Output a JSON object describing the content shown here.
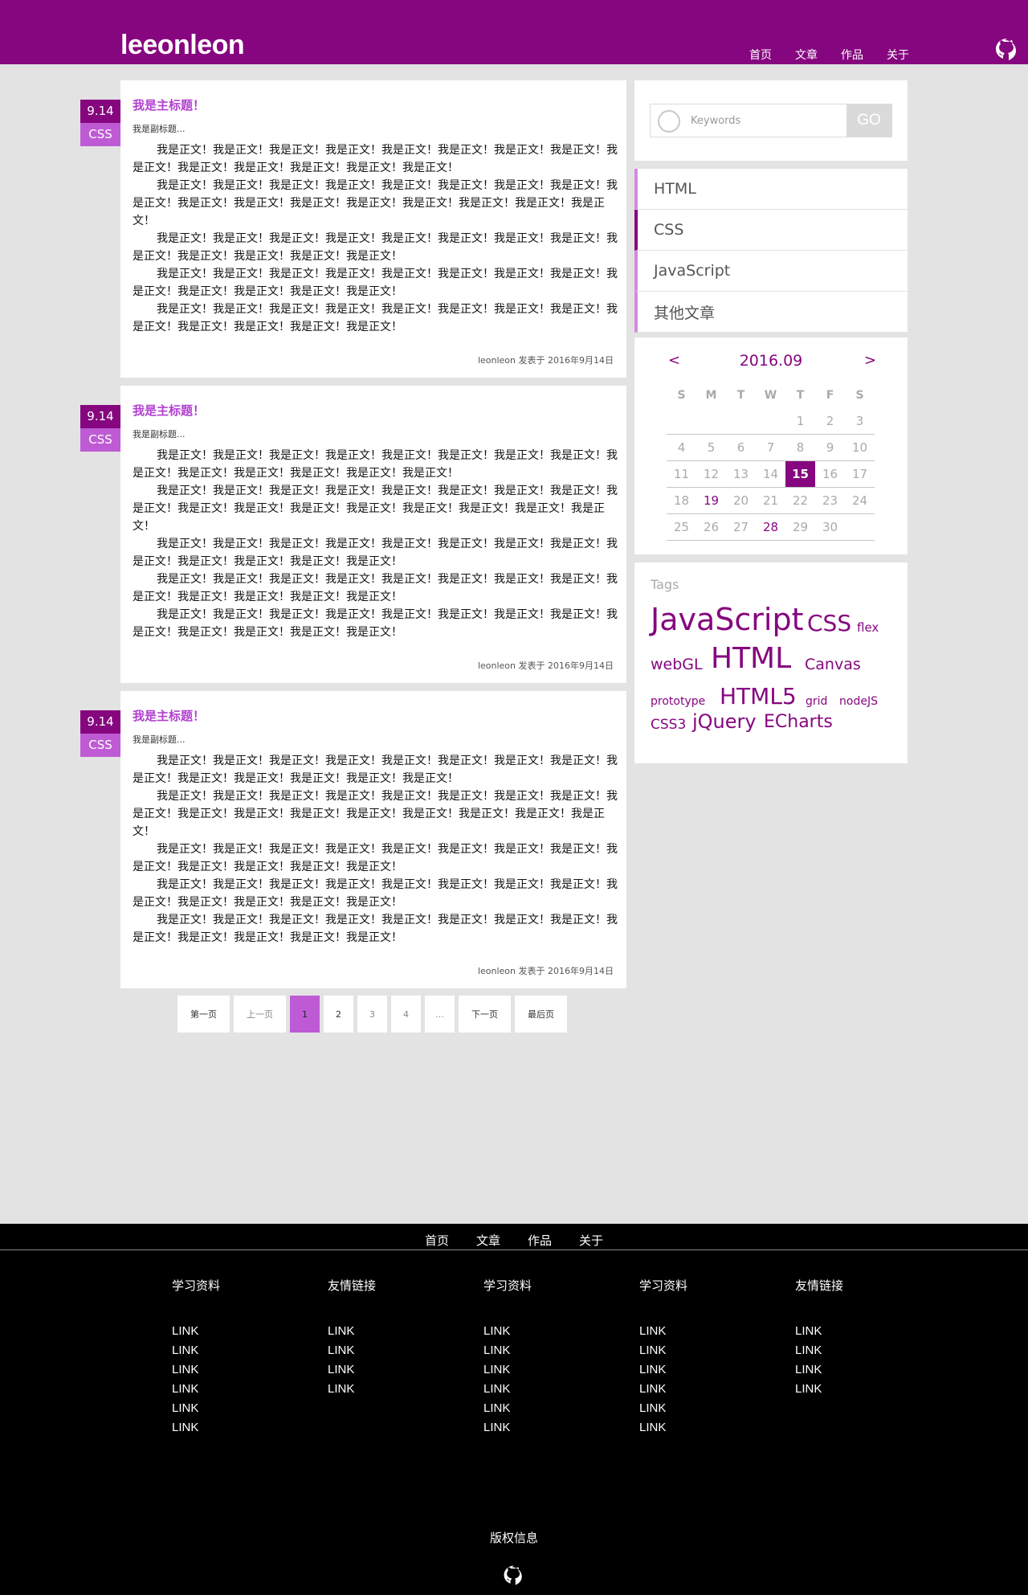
{
  "header": {
    "logo": "leeonleon",
    "nav": [
      "首页",
      "文章",
      "作品",
      "关于"
    ]
  },
  "posts": [
    {
      "date": "9.14",
      "category": "CSS",
      "title": "我是主标题！",
      "subtitle": "我是副标题...",
      "paragraphs": [
        "我是正文！我是正文！我是正文！我是正文！我是正文！我是正文！我是正文！我是正文！我是正文！我是正文！我是正文！我是正文！我是正文！我是正文！",
        "我是正文！我是正文！我是正文！我是正文！我是正文！我是正文！我是正文！我是正文！我是正文！我是正文！我是正文！我是正文！我是正文！我是正文！我是正文！我是正文！我是正文！",
        "我是正文！我是正文！我是正文！我是正文！我是正文！我是正文！我是正文！我是正文！我是正文！我是正文！我是正文！我是正文！我是正文！",
        "我是正文！我是正文！我是正文！我是正文！我是正文！我是正文！我是正文！我是正文！我是正文！我是正文！我是正文！我是正文！我是正文！",
        "我是正文！我是正文！我是正文！我是正文！我是正文！我是正文！我是正文！我是正文！我是正文！我是正文！我是正文！我是正文！我是正文！"
      ],
      "meta": "leonleon 发表于 2016年9月14日"
    },
    {
      "date": "9.14",
      "category": "CSS",
      "title": "我是主标题！",
      "subtitle": "我是副标题...",
      "paragraphs": [
        "我是正文！我是正文！我是正文！我是正文！我是正文！我是正文！我是正文！我是正文！我是正文！我是正文！我是正文！我是正文！我是正文！我是正文！",
        "我是正文！我是正文！我是正文！我是正文！我是正文！我是正文！我是正文！我是正文！我是正文！我是正文！我是正文！我是正文！我是正文！我是正文！我是正文！我是正文！我是正文！",
        "我是正文！我是正文！我是正文！我是正文！我是正文！我是正文！我是正文！我是正文！我是正文！我是正文！我是正文！我是正文！我是正文！",
        "我是正文！我是正文！我是正文！我是正文！我是正文！我是正文！我是正文！我是正文！我是正文！我是正文！我是正文！我是正文！我是正文！",
        "我是正文！我是正文！我是正文！我是正文！我是正文！我是正文！我是正文！我是正文！我是正文！我是正文！我是正文！我是正文！我是正文！"
      ],
      "meta": "leonleon 发表于 2016年9月14日"
    },
    {
      "date": "9.14",
      "category": "CSS",
      "title": "我是主标题！",
      "subtitle": "我是副标题...",
      "paragraphs": [
        "我是正文！我是正文！我是正文！我是正文！我是正文！我是正文！我是正文！我是正文！我是正文！我是正文！我是正文！我是正文！我是正文！我是正文！",
        "我是正文！我是正文！我是正文！我是正文！我是正文！我是正文！我是正文！我是正文！我是正文！我是正文！我是正文！我是正文！我是正文！我是正文！我是正文！我是正文！我是正文！",
        "我是正文！我是正文！我是正文！我是正文！我是正文！我是正文！我是正文！我是正文！我是正文！我是正文！我是正文！我是正文！我是正文！",
        "我是正文！我是正文！我是正文！我是正文！我是正文！我是正文！我是正文！我是正文！我是正文！我是正文！我是正文！我是正文！我是正文！",
        "我是正文！我是正文！我是正文！我是正文！我是正文！我是正文！我是正文！我是正文！我是正文！我是正文！我是正文！我是正文！我是正文！"
      ],
      "meta": "leonleon 发表于 2016年9月14日"
    }
  ],
  "pagination": {
    "first": "第一页",
    "prev": "上一页",
    "pages": [
      "1",
      "2",
      "3",
      "4",
      "..."
    ],
    "current": "1",
    "next": "下一页",
    "last": "最后页"
  },
  "search": {
    "placeholder": "Keywords",
    "button": "GO"
  },
  "categories": [
    "HTML",
    "CSS",
    "JavaScript",
    "其他文章"
  ],
  "active_category": "CSS",
  "calendar": {
    "prev": "<",
    "next": ">",
    "title": "2016.09",
    "weekdays": [
      "S",
      "M",
      "T",
      "W",
      "T",
      "F",
      "S"
    ],
    "weeks": [
      [
        "",
        "",
        "",
        "",
        "1",
        "2",
        "3"
      ],
      [
        "4",
        "5",
        "6",
        "7",
        "8",
        "9",
        "10"
      ],
      [
        "11",
        "12",
        "13",
        "14",
        "15",
        "16",
        "17"
      ],
      [
        "18",
        "19",
        "20",
        "21",
        "22",
        "23",
        "24"
      ],
      [
        "25",
        "26",
        "27",
        "28",
        "29",
        "30",
        ""
      ]
    ],
    "today": "15",
    "highlighted": [
      "19",
      "28"
    ]
  },
  "tags": {
    "label": "Tags",
    "items": [
      "JavaScript",
      "CSS",
      "flex",
      "webGL",
      "HTML",
      "Canvas",
      "prototype",
      "HTML5",
      "grid",
      "nodeJS",
      "CSS3",
      "jQuery",
      "ECharts"
    ]
  },
  "footer": {
    "nav": [
      "首页",
      "文章",
      "作品",
      "关于"
    ],
    "columns": [
      {
        "title": "学习资料",
        "links": [
          "LINK",
          "LINK",
          "LINK",
          "LINK",
          "LINK",
          "LINK"
        ]
      },
      {
        "title": "友情链接",
        "links": [
          "LINK",
          "LINK",
          "LINK",
          "LINK"
        ]
      },
      {
        "title": "学习资料",
        "links": [
          "LINK",
          "LINK",
          "LINK",
          "LINK",
          "LINK",
          "LINK"
        ]
      },
      {
        "title": "学习资料",
        "links": [
          "LINK",
          "LINK",
          "LINK",
          "LINK",
          "LINK",
          "LINK"
        ]
      },
      {
        "title": "友情链接",
        "links": [
          "LINK",
          "LINK",
          "LINK",
          "LINK"
        ]
      }
    ],
    "copyright": "版权信息"
  },
  "icons": {
    "github": "github-icon",
    "search": "search-icon"
  },
  "colors": {
    "brand": "#86067f",
    "accent": "#be5bd4",
    "background": "#e3e3e3",
    "footer": "#000000"
  }
}
